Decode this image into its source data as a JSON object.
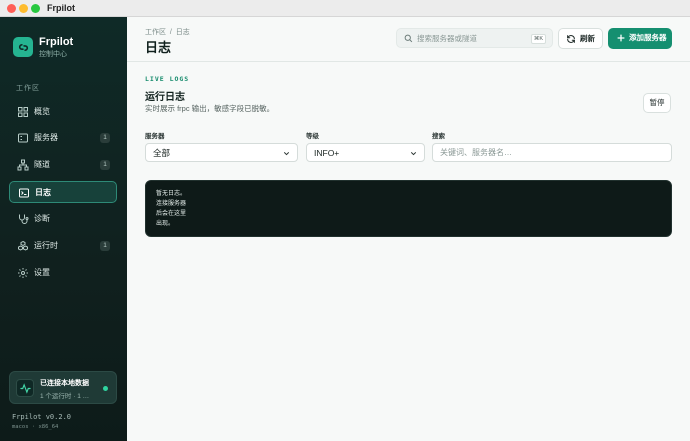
{
  "window": {
    "title": "Frpilot"
  },
  "sidebar": {
    "brand": {
      "name": "Frpilot",
      "subtitle": "控制中心"
    },
    "section_label": "工作区",
    "items": [
      {
        "label": "概览",
        "icon": "grid-icon",
        "count": ""
      },
      {
        "label": "服务器",
        "icon": "server-icon",
        "count": "1"
      },
      {
        "label": "隧道",
        "icon": "network-icon",
        "count": "1"
      },
      {
        "label": "日志",
        "icon": "terminal-icon",
        "count": "",
        "active": true
      },
      {
        "label": "诊断",
        "icon": "stethoscope-icon",
        "count": ""
      },
      {
        "label": "运行时",
        "icon": "boxes-icon",
        "count": "1"
      },
      {
        "label": "设置",
        "icon": "gear-icon",
        "count": ""
      }
    ],
    "connection": {
      "title": "已连接本地数据",
      "subtitle": "1 个运行时 · 1 …",
      "icon": "activity-icon"
    },
    "version": "Frpilot v0.2.0",
    "platform": "macos · x86_64"
  },
  "header": {
    "breadcrumb": "工作区  /  日志",
    "title": "日志",
    "search": {
      "placeholder": "搜索服务器或隧道",
      "shortcut": "⌘K"
    },
    "refresh_label": "刷新",
    "add_server_label": "添加服务器"
  },
  "logs": {
    "eyebrow": "LIVE LOGS",
    "title": "运行日志",
    "description": "实时展示 frpc 输出，敏感字段已脱敏。",
    "pause_label": "暂停",
    "filters": {
      "server_label": "服务器",
      "server_value": "全部",
      "level_label": "等级",
      "level_value": "INFO+",
      "search_label": "搜索",
      "search_placeholder": "关键词、服务器名…"
    },
    "empty_lines": [
      "暂无日志。",
      "连接服务器",
      "后会在这里",
      "出现。"
    ]
  },
  "colors": {
    "accent": "#158f70",
    "sidebar_bg": "#10201e",
    "log_bg": "#0e1a18"
  }
}
